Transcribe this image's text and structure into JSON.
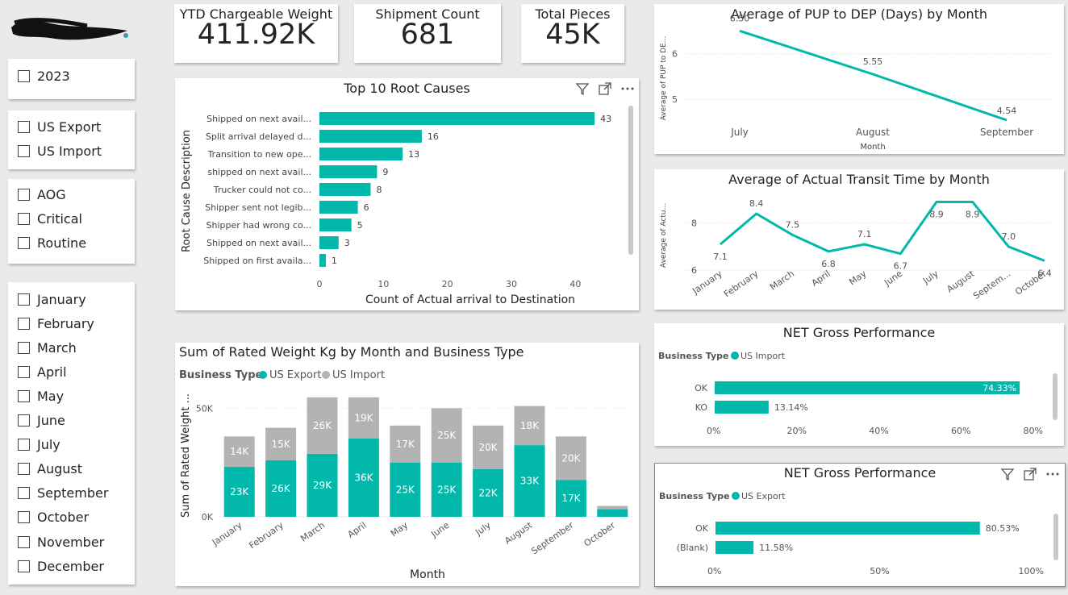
{
  "slicers": {
    "year": [
      "2023"
    ],
    "direction": [
      "US Export",
      "US Import"
    ],
    "priority": [
      "AOG",
      "Critical",
      "Routine"
    ],
    "months": [
      "January",
      "February",
      "March",
      "April",
      "May",
      "June",
      "July",
      "August",
      "September",
      "October",
      "November",
      "December"
    ]
  },
  "kpis": [
    {
      "label": "YTD Chargeable Weight",
      "value": "411.92K"
    },
    {
      "label": "Shipment Count",
      "value": "681"
    },
    {
      "label": "Total Pieces",
      "value": "45K"
    }
  ],
  "colors": {
    "teal": "#01B8AA",
    "gray": "#B3B3B3"
  },
  "chart_data": [
    {
      "id": "root_causes",
      "type": "bar",
      "orientation": "horizontal",
      "title": "Top 10 Root Causes",
      "ylabel": "Root Cause Description",
      "xlabel": "Count of Actual arrival to Destination",
      "categories": [
        "Shipped on next avail...",
        "Split arrival delayed d...",
        "Transition to new ope...",
        "shipped on next avail...",
        "Trucker could not co...",
        "Shipper sent not legib...",
        "Shipper had wrong co...",
        "Shipped on next avail...",
        "Shipped on first availa..."
      ],
      "values": [
        43,
        16,
        13,
        9,
        8,
        6,
        5,
        3,
        1
      ],
      "xlim": [
        0,
        45
      ],
      "xticks": [
        "0",
        "10",
        "20",
        "30",
        "40"
      ],
      "xtick_values": [
        0,
        10,
        20,
        30,
        40
      ]
    },
    {
      "id": "rated_weight",
      "type": "bar",
      "stacked": true,
      "title": "Sum of Rated Weight Kg by Month and Business Type",
      "legend_title": "Business Type",
      "xlabel": "Month",
      "ylabel": "Sum of Rated Weight ...",
      "categories": [
        "January",
        "February",
        "March",
        "April",
        "May",
        "June",
        "July",
        "August",
        "September",
        "October"
      ],
      "series": [
        {
          "name": "US Export",
          "values": [
            23,
            26,
            29,
            36,
            25,
            25,
            22,
            33,
            17,
            3.5
          ],
          "labels": [
            "23K",
            "26K",
            "29K",
            "36K",
            "25K",
            "25K",
            "22K",
            "33K",
            "17K",
            ""
          ]
        },
        {
          "name": "US Import",
          "values": [
            14,
            15,
            26,
            19,
            17,
            25,
            20,
            18,
            20,
            1.5
          ],
          "labels": [
            "14K",
            "15K",
            "26K",
            "19K",
            "17K",
            "25K",
            "20K",
            "18K",
            "20K",
            ""
          ]
        }
      ],
      "ylim": [
        0,
        62
      ],
      "yticks": [
        "0K",
        "50K"
      ],
      "ytick_values": [
        0,
        50
      ]
    },
    {
      "id": "pup_dep",
      "type": "line",
      "title": "Average of PUP to DEP (Days) by Month",
      "xlabel": "Month",
      "ylabel": "Average of PUP to DE...",
      "x": [
        "July",
        "August",
        "September"
      ],
      "values": [
        6.5,
        5.55,
        4.54
      ],
      "labels": [
        "6.50",
        "5.55",
        "4.54"
      ],
      "ylim": [
        4.4,
        6.7
      ],
      "yticks": [
        "5",
        "6"
      ],
      "ytick_values": [
        5,
        6
      ]
    },
    {
      "id": "transit_time",
      "type": "line",
      "title": "Average of Actual Transit Time by Month",
      "ylabel": "Average of Actu...",
      "x": [
        "January",
        "February",
        "March",
        "April",
        "May",
        "June",
        "July",
        "August",
        "Septem...",
        "October"
      ],
      "values": [
        7.1,
        8.4,
        7.5,
        6.8,
        7.1,
        6.7,
        8.9,
        8.9,
        7.0,
        6.4
      ],
      "labels": [
        "7.1",
        "8.4",
        "7.5",
        "6.8",
        "7.1",
        "6.7",
        "8.9",
        "8.9",
        "7.0",
        "6.4"
      ],
      "label_pos": [
        "below",
        "above",
        "above",
        "below",
        "above",
        "below",
        "below",
        "below",
        "above",
        "below"
      ],
      "ylim": [
        5.8,
        9.6
      ],
      "yticks": [
        "6",
        "8"
      ],
      "ytick_values": [
        6,
        8
      ]
    },
    {
      "id": "net_gross_import",
      "type": "bar",
      "orientation": "horizontal",
      "title": "NET Gross Performance",
      "legend_title": "Business Type",
      "legend": [
        "US Import"
      ],
      "categories": [
        "OK",
        "KO"
      ],
      "values": [
        74.33,
        13.14
      ],
      "labels": [
        "74.33%",
        "13.14%"
      ],
      "xlim": [
        0,
        80
      ],
      "xticks": [
        "0%",
        "20%",
        "40%",
        "60%",
        "80%"
      ],
      "xtick_values": [
        0,
        20,
        40,
        60,
        80
      ]
    },
    {
      "id": "net_gross_export",
      "type": "bar",
      "orientation": "horizontal",
      "title": "NET Gross Performance",
      "legend_title": "Business Type",
      "legend": [
        "US Export"
      ],
      "categories": [
        "OK",
        "(Blank)"
      ],
      "values": [
        80.53,
        11.58
      ],
      "labels": [
        "80.53%",
        "11.58%"
      ],
      "xlim": [
        0,
        100
      ],
      "xticks": [
        "0%",
        "50%",
        "100%"
      ],
      "xtick_values": [
        0,
        50,
        100
      ]
    }
  ]
}
